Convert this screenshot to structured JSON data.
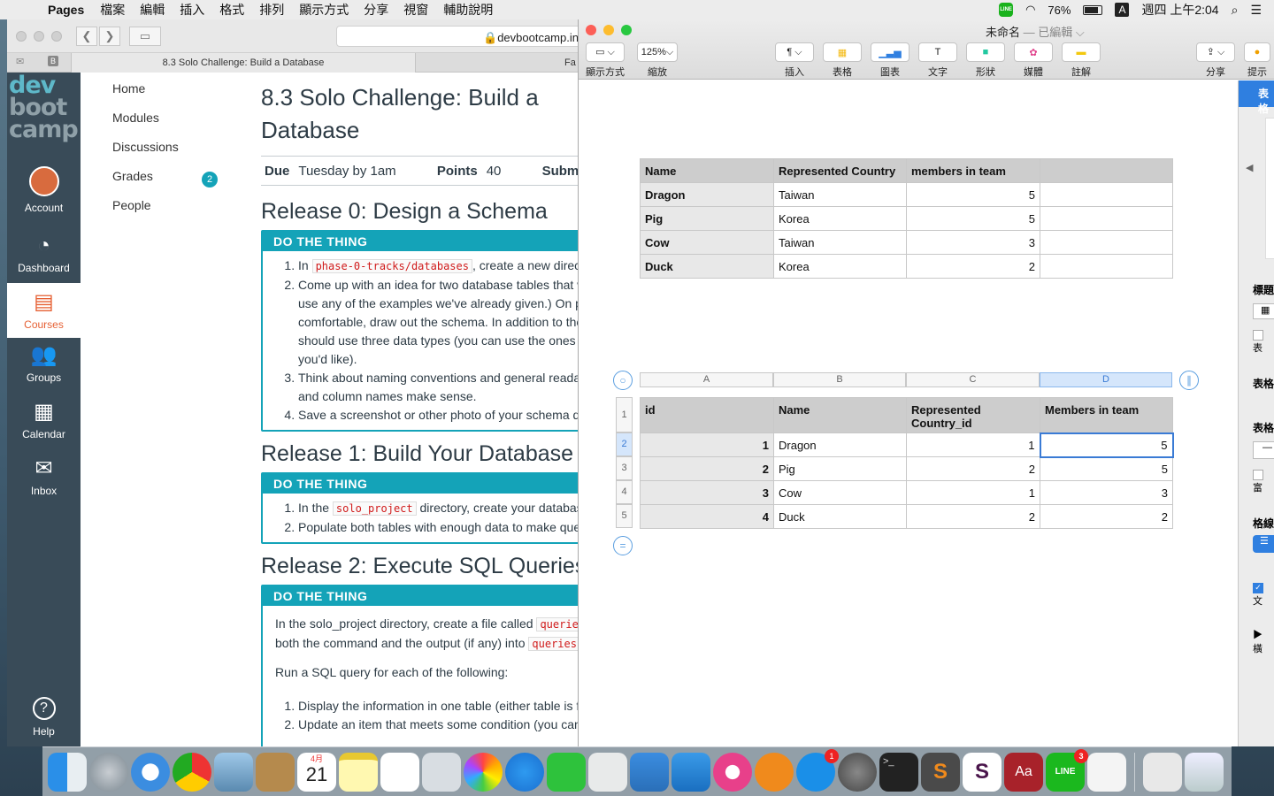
{
  "menubar": {
    "app": "Pages",
    "items": [
      "檔案",
      "編輯",
      "插入",
      "格式",
      "排列",
      "顯示方式",
      "分享",
      "視窗",
      "輔助說明"
    ],
    "battery": "76%",
    "input_method": "A",
    "clock": "週四 上午2:04"
  },
  "browser": {
    "url": "devbootcamp.in",
    "tab_title": "8.3 Solo Challenge: Build a Database",
    "tab2_title": "Fa",
    "sidebar": {
      "account": "Account",
      "dashboard": "Dashboard",
      "courses": "Courses",
      "groups": "Groups",
      "calendar": "Calendar",
      "inbox": "Inbox",
      "help": "Help"
    },
    "logo": [
      "dev",
      "boot",
      "camp"
    ],
    "course_nav": [
      "Home",
      "Modules",
      "Discussions",
      "Grades",
      "People"
    ],
    "grades_badge": "2",
    "page_title": "8.3 Solo Challenge: Build a Database",
    "due_label": "Due",
    "due_value": "Tuesday by 1am",
    "points_label": "Points",
    "points_value": "40",
    "submit_label": "Submit",
    "r0_title": "Release 0: Design a Schema",
    "box_head": "DO THE THING",
    "r0_items": [
      {
        "pre": "In ",
        "code": "phase-0-tracks/databases",
        "post": ", create a new direc"
      },
      {
        "line1": "Come up with an idea for two database tables that w",
        "line2": "use any of the examples we've already given.) On pa",
        "line3": "comfortable, draw out the schema. In addition to the",
        "line4": "should use three data types (you can use the ones w",
        "line5": "you'd like)."
      },
      {
        "line1": "Think about naming conventions and general readab",
        "line2": "and column names make sense."
      },
      {
        "line1": "Save a screenshot or other photo of your schema dr"
      }
    ],
    "r1_title": "Release 1: Build Your Database",
    "r1_items": [
      {
        "pre": "In the ",
        "code": "solo_project",
        "post": " directory, create your databas"
      },
      {
        "line1": "Populate both tables with enough data to make quer"
      }
    ],
    "r2_title": "Release 2: Execute SQL Queries",
    "r2_p1_pre": "In the solo_project directory, create a file called ",
    "r2_p1_code": "queries",
    "r2_p2_pre": "both the command and the output (if any) into ",
    "r2_p2_code": "queries.",
    "r2_p3": "Run a SQL query for each of the following:",
    "r2_items": [
      "Display the information in one table (either table is fin",
      "Update an item that meets some condition (you can"
    ]
  },
  "pages": {
    "title": "未命名",
    "edited": "— 已編輯 ⌵",
    "toolbar": {
      "view": "顯示方式",
      "zoom": "縮放",
      "zoom_value": "125%",
      "insert": "插入",
      "table": "表格",
      "chart": "圖表",
      "text": "文字",
      "shape": "形狀",
      "media": "媒體",
      "comment": "註解",
      "share": "分享",
      "tips": "提示"
    },
    "inspector": {
      "tab": "表格",
      "title": "標題",
      "table_label": "表格",
      "table2": "表格",
      "grid": "格線",
      "check1": "表",
      "check2": "富",
      "check3": "文",
      "expand": "橫"
    },
    "table1": {
      "headers": [
        "Name",
        "Represented Country",
        "members in team",
        ""
      ],
      "rows": [
        [
          "Dragon",
          "Taiwan",
          "5",
          ""
        ],
        [
          "Pig",
          "Korea",
          "5",
          ""
        ],
        [
          "Cow",
          "Taiwan",
          "3",
          ""
        ],
        [
          "Duck",
          "Korea",
          "2",
          ""
        ]
      ]
    },
    "table2": {
      "col_letters": [
        "A",
        "B",
        "C",
        "D"
      ],
      "row_numbers": [
        "1",
        "2",
        "3",
        "4",
        "5"
      ],
      "headers": [
        "id",
        "Name",
        "Represented Country_id",
        "Members in team"
      ],
      "rows": [
        [
          "1",
          "Dragon",
          "1",
          "5"
        ],
        [
          "2",
          "Pig",
          "2",
          "5"
        ],
        [
          "3",
          "Cow",
          "1",
          "3"
        ],
        [
          "4",
          "Duck",
          "2",
          "2"
        ]
      ]
    }
  },
  "dock": {
    "calendar_month": "4月",
    "calendar_day": "21",
    "appstore_badge": "1",
    "line_badge": "3"
  }
}
